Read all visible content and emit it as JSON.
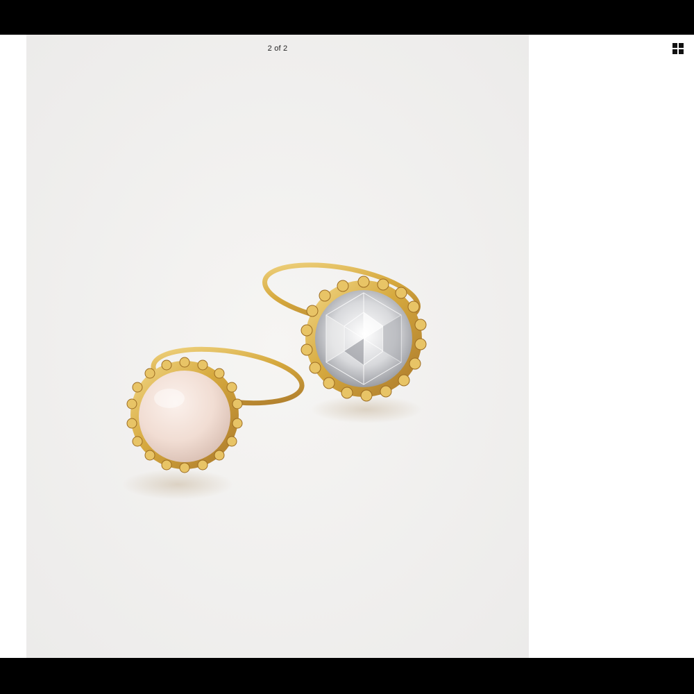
{
  "viewer": {
    "counter_text": "2 of 2",
    "grid_icon": "grid-icon"
  },
  "colors": {
    "letterbox": "#000000",
    "page_background": "#ffffff",
    "photo_background": "#f2f2f1",
    "gold": "#d6a93e",
    "pearl": "#f1ddd3"
  }
}
